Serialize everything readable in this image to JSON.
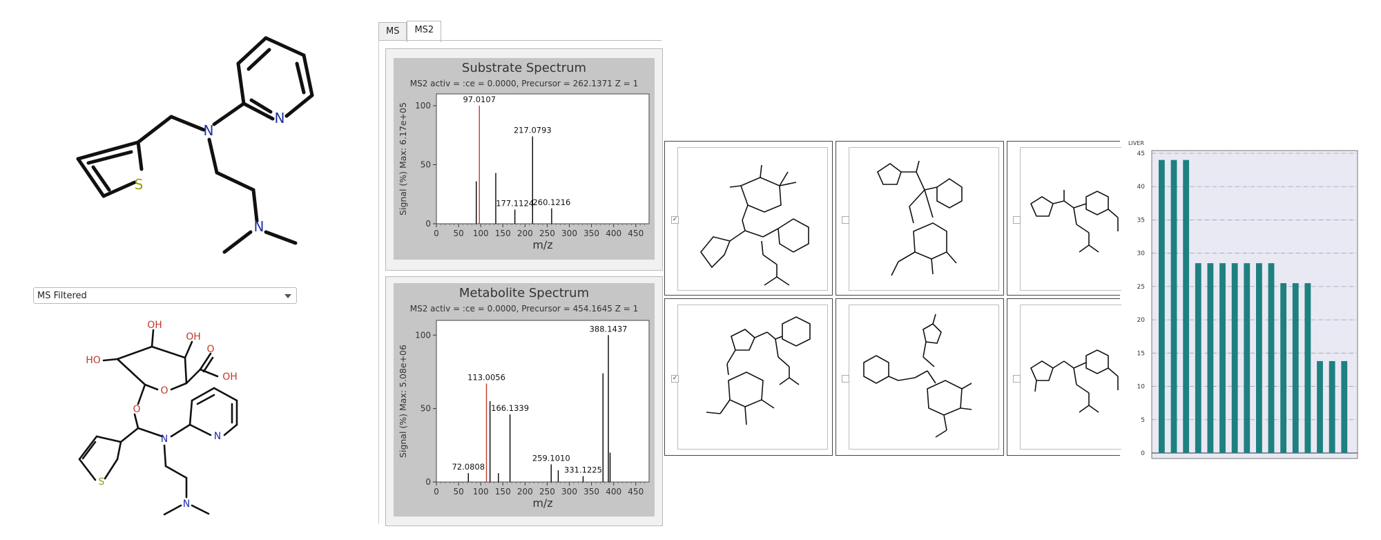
{
  "main_molecule": {
    "atoms": [
      "N",
      "N",
      "S",
      "N"
    ]
  },
  "filter_dropdown": {
    "value": "MS Filtered"
  },
  "filtered_molecule": {
    "labels": [
      "OH",
      "OH",
      "HO",
      "OH",
      "O",
      "O",
      "O",
      "N",
      "N",
      "S",
      "N"
    ]
  },
  "tabs": [
    {
      "label": "MS",
      "active": false
    },
    {
      "label": "MS2",
      "active": true
    }
  ],
  "substrate_spectrum": {
    "title": "Substrate Spectrum",
    "subtitle": "MS2  activ = :ce = 0.0000, Precursor = 262.1371 Z = 1",
    "ylabel": "Signal (%) Max: 6.17e+05",
    "xlabel": "m/z",
    "x_ticks": [
      "0",
      "50",
      "100",
      "150",
      "200",
      "250",
      "300",
      "350",
      "400",
      "450"
    ],
    "y_ticks": [
      "0",
      "50",
      "100"
    ],
    "peaks": [
      {
        "mz": 90,
        "intensity": 36,
        "label": "",
        "color": "#000000"
      },
      {
        "mz": 97.0107,
        "intensity": 100,
        "label": "97.0107",
        "color": "#c0392b"
      },
      {
        "mz": 134,
        "intensity": 43,
        "label": "",
        "color": "#000000"
      },
      {
        "mz": 177.1124,
        "intensity": 12,
        "label": "177.1124",
        "color": "#000000"
      },
      {
        "mz": 217.0793,
        "intensity": 74,
        "label": "217.0793",
        "color": "#000000"
      },
      {
        "mz": 260.1216,
        "intensity": 13,
        "label": "260.1216",
        "color": "#000000"
      }
    ]
  },
  "metabolite_spectrum": {
    "title": "Metabolite Spectrum",
    "subtitle": "MS2  activ = :ce = 0.0000, Precursor = 454.1645 Z = 1",
    "ylabel": "Signal (%) Max: 5.08e+06",
    "xlabel": "m/z",
    "x_ticks": [
      "0",
      "50",
      "100",
      "150",
      "200",
      "250",
      "300",
      "350",
      "400",
      "450"
    ],
    "y_ticks": [
      "0",
      "50",
      "100"
    ],
    "peaks": [
      {
        "mz": 72.0808,
        "intensity": 6,
        "label": "72.0808",
        "color": "#000000"
      },
      {
        "mz": 113.0056,
        "intensity": 67,
        "label": "113.0056",
        "color": "#c0392b"
      },
      {
        "mz": 121,
        "intensity": 55,
        "label": "",
        "color": "#000000"
      },
      {
        "mz": 140,
        "intensity": 6,
        "label": "",
        "color": "#000000"
      },
      {
        "mz": 166.1339,
        "intensity": 46,
        "label": "166.1339",
        "color": "#000000"
      },
      {
        "mz": 259.101,
        "intensity": 12,
        "label": "259.1010",
        "color": "#000000"
      },
      {
        "mz": 275,
        "intensity": 8,
        "label": "",
        "color": "#000000"
      },
      {
        "mz": 331.1225,
        "intensity": 4,
        "label": "331.1225",
        "color": "#000000"
      },
      {
        "mz": 376,
        "intensity": 74,
        "label": "",
        "color": "#000000"
      },
      {
        "mz": 388.1437,
        "intensity": 100,
        "label": "388.1437",
        "color": "#000000"
      },
      {
        "mz": 392,
        "intensity": 20,
        "label": "",
        "color": "#000000"
      }
    ]
  },
  "structure_grid": {
    "cells": [
      {
        "checked": true
      },
      {
        "checked": false
      },
      {
        "checked": false
      },
      {
        "checked": true
      },
      {
        "checked": false
      },
      {
        "checked": false
      }
    ]
  },
  "chart_data": {
    "type": "bar",
    "title": "LIVER",
    "ylim": [
      0,
      45
    ],
    "y_ticks": [
      "0",
      "5",
      "10",
      "15",
      "20",
      "25",
      "30",
      "35",
      "40",
      "45"
    ],
    "values": [
      44,
      44,
      44,
      28.5,
      28.5,
      28.5,
      28.5,
      28.5,
      28.5,
      28.5,
      25.5,
      25.5,
      25.5,
      13.8,
      13.8,
      13.8
    ],
    "bar_color": "#1f8080",
    "grid": true
  }
}
